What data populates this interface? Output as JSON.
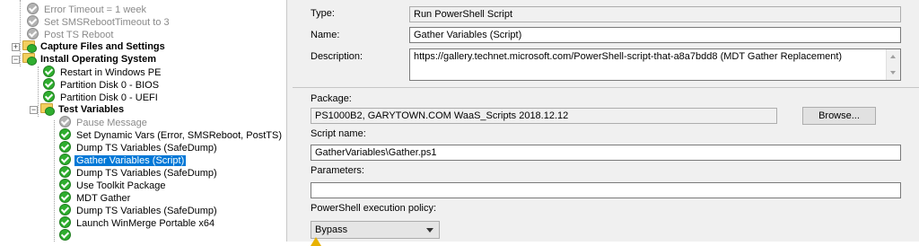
{
  "tree": {
    "items": [
      {
        "label": "Error Timeout = 1 week",
        "icon": "gray-check-icon",
        "state": "disabled"
      },
      {
        "label": "Set SMSRebootTimeout to 3",
        "icon": "gray-check-icon",
        "state": "disabled"
      },
      {
        "label": "Post TS Reboot",
        "icon": "gray-check-icon",
        "state": "disabled"
      },
      {
        "label": "Capture Files and Settings",
        "icon": "folder-icon",
        "state": "bold",
        "expander": "+"
      },
      {
        "label": "Install Operating System",
        "icon": "folder-icon",
        "state": "bold",
        "expander": "-"
      },
      {
        "label": "Restart in Windows PE",
        "icon": "green-check-icon",
        "state": "normal"
      },
      {
        "label": "Partition Disk 0 - BIOS",
        "icon": "green-check-icon",
        "state": "normal"
      },
      {
        "label": "Partition Disk 0 - UEFI",
        "icon": "green-check-icon",
        "state": "normal"
      },
      {
        "label": "Test  Variables",
        "icon": "folder-icon",
        "state": "bold",
        "expander": "-"
      },
      {
        "label": "Pause Message",
        "icon": "gray-check-icon",
        "state": "disabled"
      },
      {
        "label": "Set Dynamic Vars (Error, SMSReboot, PostTS)",
        "icon": "green-check-icon",
        "state": "normal"
      },
      {
        "label": "Dump TS Variables (SafeDump)",
        "icon": "green-check-icon",
        "state": "normal"
      },
      {
        "label": "Gather Variables (Script)",
        "icon": "green-check-icon",
        "state": "selected"
      },
      {
        "label": "Dump TS Variables (SafeDump)",
        "icon": "green-check-icon",
        "state": "normal"
      },
      {
        "label": "Use Toolkit Package",
        "icon": "green-check-icon",
        "state": "normal"
      },
      {
        "label": "MDT Gather",
        "icon": "green-check-icon",
        "state": "normal"
      },
      {
        "label": "Dump TS Variables (SafeDump)",
        "icon": "green-check-icon",
        "state": "normal"
      },
      {
        "label": "Launch  WinMerge Portable x64",
        "icon": "green-check-icon",
        "state": "normal"
      }
    ]
  },
  "props": {
    "type_label": "Type:",
    "type_value": "Run PowerShell Script",
    "name_label": "Name:",
    "name_value": "Gather Variables (Script)",
    "description_label": "Description:",
    "description_value": "https://gallery.technet.microsoft.com/PowerShell-script-that-a8a7bdd8 (MDT Gather  Replacement)",
    "package_label": "Package:",
    "package_value": "PS1000B2, GARYTOWN.COM WaaS_Scripts 2018.12.12",
    "browse_label": "Browse...",
    "script_name_label": "Script name:",
    "script_name_value": "GatherVariables\\Gather.ps1",
    "parameters_label": "Parameters:",
    "parameters_value": "",
    "policy_label": "PowerShell execution policy:",
    "policy_value": "Bypass"
  },
  "colors": {
    "selection": "#0078d7",
    "check_green": "#2fae2f",
    "panel_bg": "#f0f0f0"
  }
}
